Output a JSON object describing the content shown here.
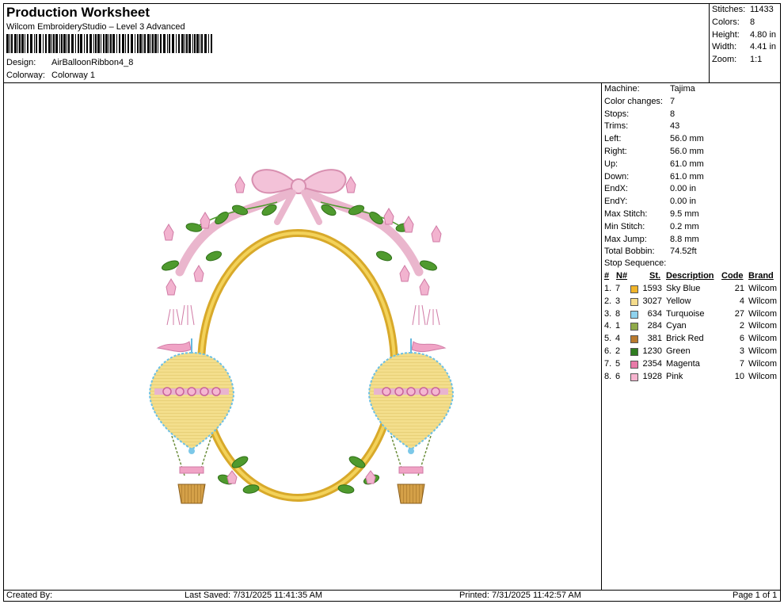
{
  "header": {
    "title": "Production Worksheet",
    "software": "Wilcom EmbroideryStudio – Level 3 Advanced",
    "design_label": "Design:",
    "design_value": "AirBalloonRibbon4_8",
    "colorway_label": "Colorway:",
    "colorway_value": "Colorway 1"
  },
  "summary": [
    {
      "label": "Stitches:",
      "value": "11433"
    },
    {
      "label": "Colors:",
      "value": "8"
    },
    {
      "label": "Height:",
      "value": "4.80 in"
    },
    {
      "label": "Width:",
      "value": "4.41 in"
    },
    {
      "label": "Zoom:",
      "value": "1:1"
    }
  ],
  "machine_info": [
    {
      "label": "Machine:",
      "value": "Tajima"
    },
    {
      "label": "Color changes:",
      "value": "7"
    },
    {
      "label": "Stops:",
      "value": "8"
    },
    {
      "label": "Trims:",
      "value": "43"
    },
    {
      "label": "Left:",
      "value": "56.0 mm"
    },
    {
      "label": "Right:",
      "value": "56.0 mm"
    },
    {
      "label": "Up:",
      "value": "61.0 mm"
    },
    {
      "label": "Down:",
      "value": "61.0 mm"
    },
    {
      "label": "EndX:",
      "value": "0.00 in"
    },
    {
      "label": "EndY:",
      "value": "0.00 in"
    },
    {
      "label": "Max Stitch:",
      "value": "9.5 mm"
    },
    {
      "label": "Min Stitch:",
      "value": "0.2 mm"
    },
    {
      "label": "Max Jump:",
      "value": "8.8 mm"
    },
    {
      "label": "Total Bobbin:",
      "value": "74.52ft"
    }
  ],
  "stop_sequence": {
    "title": "Stop Sequence:",
    "columns": {
      "num": "#",
      "n": "N#",
      "st": "St.",
      "desc": "Description",
      "code": "Code",
      "brand": "Brand"
    },
    "rows": [
      {
        "num": "1.",
        "n": "7",
        "color": "#f0b429",
        "st": "1593",
        "desc": "Sky Blue",
        "code": "21",
        "brand": "Wilcom"
      },
      {
        "num": "2.",
        "n": "3",
        "color": "#f5dc8c",
        "st": "3027",
        "desc": "Yellow",
        "code": "4",
        "brand": "Wilcom"
      },
      {
        "num": "3.",
        "n": "8",
        "color": "#8fd2ee",
        "st": "634",
        "desc": "Turquoise",
        "code": "27",
        "brand": "Wilcom"
      },
      {
        "num": "4.",
        "n": "1",
        "color": "#8faa4a",
        "st": "284",
        "desc": "Cyan",
        "code": "2",
        "brand": "Wilcom"
      },
      {
        "num": "5.",
        "n": "4",
        "color": "#b97a2e",
        "st": "381",
        "desc": "Brick Red",
        "code": "6",
        "brand": "Wilcom"
      },
      {
        "num": "6.",
        "n": "2",
        "color": "#2f7d20",
        "st": "1230",
        "desc": "Green",
        "code": "3",
        "brand": "Wilcom"
      },
      {
        "num": "7.",
        "n": "5",
        "color": "#e87aa8",
        "st": "2354",
        "desc": "Magenta",
        "code": "7",
        "brand": "Wilcom"
      },
      {
        "num": "8.",
        "n": "6",
        "color": "#f6b4cf",
        "st": "1928",
        "desc": "Pink",
        "code": "10",
        "brand": "Wilcom"
      }
    ]
  },
  "footer": {
    "created_by": "Created By:",
    "last_saved": "Last Saved: 7/31/2025 11:41:35 AM",
    "printed": "Printed: 7/31/2025 11:42:57 AM",
    "page": "Page 1 of 1"
  }
}
